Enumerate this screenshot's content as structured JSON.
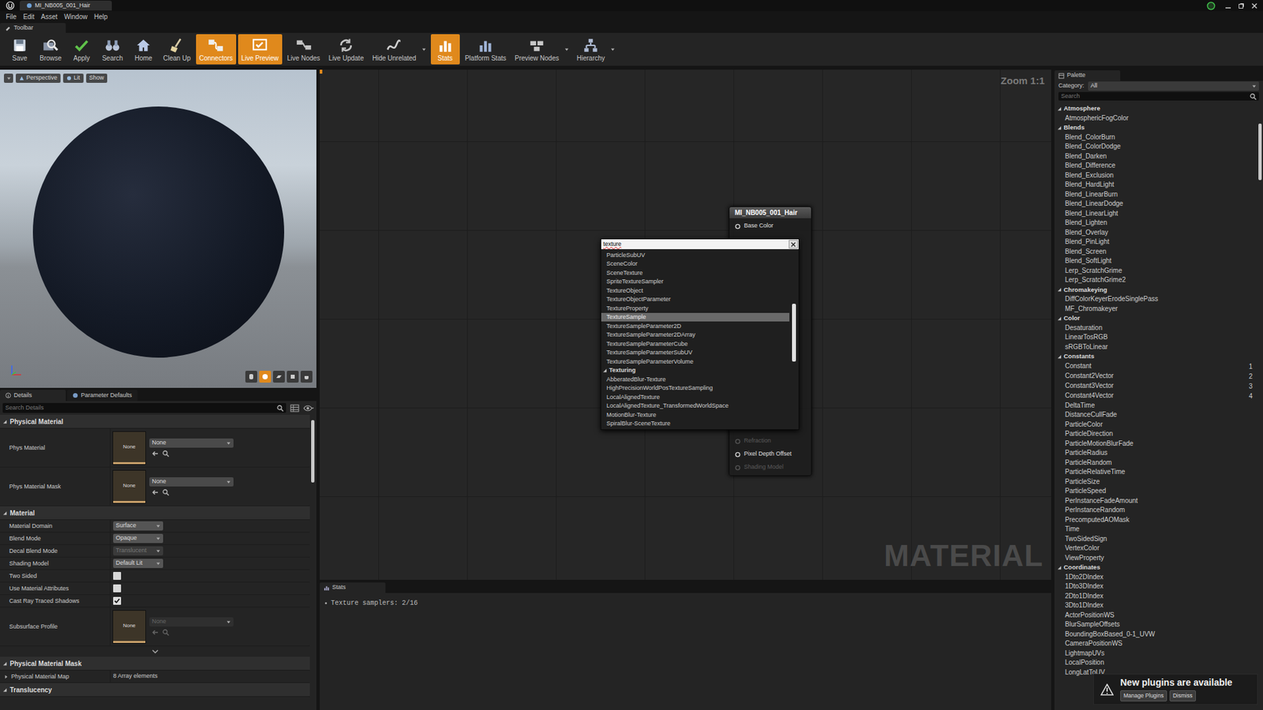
{
  "window": {
    "tab_title": "MI_NB005_001_Hair"
  },
  "menu": [
    "File",
    "Edit",
    "Asset",
    "Window",
    "Help"
  ],
  "toolbar": {
    "label": "Toolbar",
    "buttons": [
      {
        "label": "Save",
        "selected": false,
        "has_dropdown": false
      },
      {
        "label": "Browse",
        "selected": false,
        "has_dropdown": false
      },
      {
        "label": "Apply",
        "selected": false,
        "has_dropdown": false
      },
      {
        "label": "Search",
        "selected": false,
        "has_dropdown": false
      },
      {
        "label": "Home",
        "selected": false,
        "has_dropdown": false
      },
      {
        "label": "Clean Up",
        "selected": false,
        "has_dropdown": false
      },
      {
        "label": "Connectors",
        "selected": true,
        "has_dropdown": false
      },
      {
        "label": "Live Preview",
        "selected": true,
        "has_dropdown": false
      },
      {
        "label": "Live Nodes",
        "selected": false,
        "has_dropdown": false
      },
      {
        "label": "Live Update",
        "selected": false,
        "has_dropdown": false
      },
      {
        "label": "Hide Unrelated",
        "selected": false,
        "has_dropdown": true
      },
      {
        "label": "Stats",
        "selected": true,
        "has_dropdown": false
      },
      {
        "label": "Platform Stats",
        "selected": false,
        "has_dropdown": false
      },
      {
        "label": "Preview Nodes",
        "selected": false,
        "has_dropdown": true
      },
      {
        "label": "Hierarchy",
        "selected": false,
        "has_dropdown": true
      }
    ]
  },
  "viewport": {
    "buttons": [
      "Perspective",
      "Lit",
      "Show"
    ]
  },
  "details": {
    "tabs": [
      {
        "label": "Details",
        "selected": true
      },
      {
        "label": "Parameter Defaults",
        "selected": false
      }
    ],
    "search": {
      "placeholder": "Search Details"
    },
    "sections": [
      {
        "title": "Physical Material",
        "expanded": true,
        "rows": [
          {
            "label": "Phys Material",
            "kind": "asset",
            "thumb": "None",
            "value": "None",
            "disabled": false
          },
          {
            "label": "Phys Material Mask",
            "kind": "asset",
            "thumb": "None",
            "value": "None",
            "disabled": false
          }
        ]
      },
      {
        "title": "Material",
        "expanded": true,
        "rows": [
          {
            "label": "Material Domain",
            "kind": "dropdown",
            "value": "Surface",
            "disabled": false
          },
          {
            "label": "Blend Mode",
            "kind": "dropdown",
            "value": "Opaque",
            "disabled": false
          },
          {
            "label": "Decal Blend Mode",
            "kind": "dropdown",
            "value": "Translucent",
            "disabled": true
          },
          {
            "label": "Shading Model",
            "kind": "dropdown",
            "value": "Default Lit",
            "disabled": false
          },
          {
            "label": "Two Sided",
            "kind": "checkbox",
            "checked": false
          },
          {
            "label": "Use Material Attributes",
            "kind": "checkbox",
            "checked": false
          },
          {
            "label": "Cast Ray Traced Shadows",
            "kind": "checkbox",
            "checked": true
          },
          {
            "label": "Subsurface Profile",
            "kind": "asset",
            "thumb": "None",
            "value": "None",
            "disabled": true
          },
          {
            "label": "",
            "kind": "advanced",
            "expanded": false
          }
        ]
      },
      {
        "title": "Physical Material Mask",
        "expanded": true,
        "rows": [
          {
            "label": "Physical Material Map",
            "kind": "array",
            "value": "8 Array elements",
            "expanded": false
          }
        ]
      },
      {
        "title": "Translucency",
        "expanded": true,
        "rows": []
      }
    ]
  },
  "graph": {
    "zoom": "Zoom 1:1",
    "watermark": "MATERIAL",
    "node": {
      "title": "MI_NB005_001_Hair",
      "pins_top": [
        {
          "label": "Base Color",
          "disabled": false
        }
      ],
      "pins_bottom": [
        {
          "label": "Refraction",
          "disabled": true
        },
        {
          "label": "Pixel Depth Offset",
          "disabled": false
        },
        {
          "label": "Shading Model",
          "disabled": true
        }
      ]
    }
  },
  "context_menu": {
    "query": "texture",
    "scroll_level": 0.3,
    "items": [
      {
        "label": "ParticleSubUV",
        "kind": "item",
        "selected": false
      },
      {
        "label": "SceneColor",
        "kind": "item",
        "selected": false
      },
      {
        "label": "SceneTexture",
        "kind": "item",
        "selected": false
      },
      {
        "label": "SpriteTextureSampler",
        "kind": "item",
        "selected": false
      },
      {
        "label": "TextureObject",
        "kind": "item",
        "selected": false
      },
      {
        "label": "TextureObjectParameter",
        "kind": "item",
        "selected": false
      },
      {
        "label": "TextureProperty",
        "kind": "item",
        "selected": false
      },
      {
        "label": "TextureSample",
        "kind": "item",
        "selected": true
      },
      {
        "label": "TextureSampleParameter2D",
        "kind": "item",
        "selected": false
      },
      {
        "label": "TextureSampleParameter2DArray",
        "kind": "item",
        "selected": false
      },
      {
        "label": "TextureSampleParameterCube",
        "kind": "item",
        "selected": false
      },
      {
        "label": "TextureSampleParameterSubUV",
        "kind": "item",
        "selected": false
      },
      {
        "label": "TextureSampleParameterVolume",
        "kind": "item",
        "selected": false
      },
      {
        "label": "Texturing",
        "kind": "category",
        "selected": false,
        "expanded": true
      },
      {
        "label": "AbberatedBlur-Texture",
        "kind": "item",
        "selected": false
      },
      {
        "label": "HighPrecisionWorldPosTextureSampling",
        "kind": "item",
        "selected": false
      },
      {
        "label": "LocalAlignedTexture",
        "kind": "item",
        "selected": false
      },
      {
        "label": "LocalAlignedTexture_TransformedWorldSpace",
        "kind": "item",
        "selected": false
      },
      {
        "label": "MotionBlur-Texture",
        "kind": "item",
        "selected": false
      },
      {
        "label": "SpiralBlur-SceneTexture",
        "kind": "item",
        "selected": false
      }
    ]
  },
  "stats": {
    "tab": "Stats",
    "lines": [
      "Texture samplers: 2/16"
    ]
  },
  "palette": {
    "tab": "Palette",
    "category_label": "Category:",
    "category_value": "All",
    "search": {
      "placeholder": "Search"
    },
    "items": [
      {
        "label": "Atmosphere",
        "kind": "category",
        "expanded": true
      },
      {
        "label": "AtmosphericFogColor",
        "kind": "item"
      },
      {
        "label": "Blends",
        "kind": "category",
        "expanded": true
      },
      {
        "label": "Blend_ColorBurn",
        "kind": "item"
      },
      {
        "label": "Blend_ColorDodge",
        "kind": "item"
      },
      {
        "label": "Blend_Darken",
        "kind": "item"
      },
      {
        "label": "Blend_Difference",
        "kind": "item"
      },
      {
        "label": "Blend_Exclusion",
        "kind": "item"
      },
      {
        "label": "Blend_HardLight",
        "kind": "item"
      },
      {
        "label": "Blend_LinearBurn",
        "kind": "item"
      },
      {
        "label": "Blend_LinearDodge",
        "kind": "item"
      },
      {
        "label": "Blend_LinearLight",
        "kind": "item"
      },
      {
        "label": "Blend_Lighten",
        "kind": "item"
      },
      {
        "label": "Blend_Overlay",
        "kind": "item"
      },
      {
        "label": "Blend_PinLight",
        "kind": "item"
      },
      {
        "label": "Blend_Screen",
        "kind": "item"
      },
      {
        "label": "Blend_SoftLight",
        "kind": "item"
      },
      {
        "label": "Lerp_ScratchGrime",
        "kind": "item"
      },
      {
        "label": "Lerp_ScratchGrime2",
        "kind": "item"
      },
      {
        "label": "Chromakeying",
        "kind": "category",
        "expanded": true
      },
      {
        "label": "DiffColorKeyerErodeSinglePass",
        "kind": "item"
      },
      {
        "label": "MF_Chromakeyer",
        "kind": "item"
      },
      {
        "label": "Color",
        "kind": "category",
        "expanded": true
      },
      {
        "label": "Desaturation",
        "kind": "item"
      },
      {
        "label": "LinearTosRGB",
        "kind": "item"
      },
      {
        "label": "sRGBToLinear",
        "kind": "item"
      },
      {
        "label": "Constants",
        "kind": "category",
        "expanded": true
      },
      {
        "label": "Constant",
        "kind": "item",
        "shortcut": "1"
      },
      {
        "label": "Constant2Vector",
        "kind": "item",
        "shortcut": "2"
      },
      {
        "label": "Constant3Vector",
        "kind": "item",
        "shortcut": "3"
      },
      {
        "label": "Constant4Vector",
        "kind": "item",
        "shortcut": "4"
      },
      {
        "label": "DeltaTime",
        "kind": "item"
      },
      {
        "label": "DistanceCullFade",
        "kind": "item"
      },
      {
        "label": "ParticleColor",
        "kind": "item"
      },
      {
        "label": "ParticleDirection",
        "kind": "item"
      },
      {
        "label": "ParticleMotionBlurFade",
        "kind": "item"
      },
      {
        "label": "ParticleRadius",
        "kind": "item"
      },
      {
        "label": "ParticleRandom",
        "kind": "item"
      },
      {
        "label": "ParticleRelativeTime",
        "kind": "item"
      },
      {
        "label": "ParticleSize",
        "kind": "item"
      },
      {
        "label": "ParticleSpeed",
        "kind": "item"
      },
      {
        "label": "PerInstanceFadeAmount",
        "kind": "item"
      },
      {
        "label": "PerInstanceRandom",
        "kind": "item"
      },
      {
        "label": "PrecomputedAOMask",
        "kind": "item"
      },
      {
        "label": "Time",
        "kind": "item"
      },
      {
        "label": "TwoSidedSign",
        "kind": "item"
      },
      {
        "label": "VertexColor",
        "kind": "item"
      },
      {
        "label": "ViewProperty",
        "kind": "item"
      },
      {
        "label": "Coordinates",
        "kind": "category",
        "expanded": true
      },
      {
        "label": "1Dto2DIndex",
        "kind": "item"
      },
      {
        "label": "1Dto3DIndex",
        "kind": "item"
      },
      {
        "label": "2Dto1DIndex",
        "kind": "item"
      },
      {
        "label": "3Dto1DIndex",
        "kind": "item"
      },
      {
        "label": "ActorPositionWS",
        "kind": "item"
      },
      {
        "label": "BlurSampleOffsets",
        "kind": "item"
      },
      {
        "label": "BoundingBoxBased_0-1_UVW",
        "kind": "item"
      },
      {
        "label": "CameraPositionWS",
        "kind": "item"
      },
      {
        "label": "LightmapUVs",
        "kind": "item"
      },
      {
        "label": "LocalPosition",
        "kind": "item"
      },
      {
        "label": "LongLatToUV",
        "kind": "item"
      }
    ]
  },
  "notification": {
    "message": "New plugins are available",
    "buttons": [
      "Manage Plugins",
      "Dismiss"
    ]
  }
}
